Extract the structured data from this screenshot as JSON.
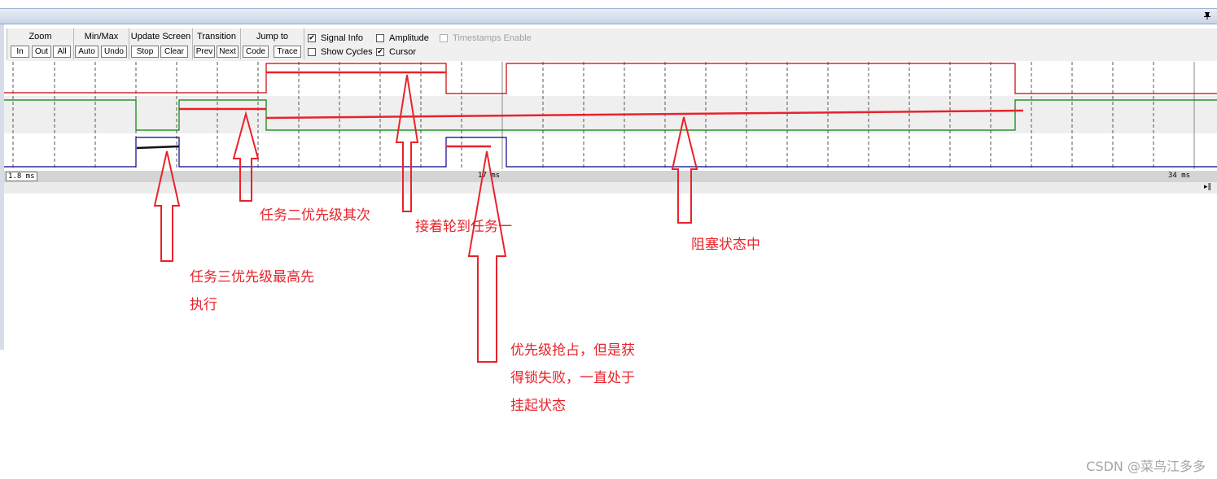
{
  "toolbar": {
    "zoom": {
      "title": "Zoom",
      "in": "In",
      "out": "Out",
      "all": "All"
    },
    "minmax": {
      "title": "Min/Max",
      "auto": "Auto",
      "undo": "Undo"
    },
    "update": {
      "title": "Update Screen",
      "stop": "Stop",
      "clear": "Clear"
    },
    "transition": {
      "title": "Transition",
      "prev": "Prev",
      "next": "Next"
    },
    "jump": {
      "title": "Jump to",
      "code": "Code",
      "trace": "Trace"
    },
    "options": {
      "signal_info": "Signal Info",
      "show_cycles": "Show Cycles",
      "amplitude": "Amplitude",
      "cursor": "Cursor",
      "timestamps": "Timestamps Enable"
    }
  },
  "checks": {
    "signal_info": true,
    "show_cycles": false,
    "amplitude": false,
    "cursor": true,
    "timestamps": false
  },
  "timeline": {
    "left": "1.8 ms",
    "cursor": "17 ms",
    "right": "34 ms"
  },
  "annotations": {
    "task3_line1": "任务三优先级最高先",
    "task3_line2": "执行",
    "task2": "任务二优先级其次",
    "task1_next": "接着轮到任务一",
    "blocked": "阻塞状态中",
    "preempt_line1": "优先级抢占，但是获",
    "preempt_line2": "得锁失败，一直处于",
    "preempt_line3": "挂起状态"
  },
  "watermark": "CSDN @菜鸟江多多",
  "colors": {
    "task_red": "#cc0000",
    "task_green": "#008000",
    "task_blue": "#00008b",
    "annotation": "#e8232b"
  },
  "icons": {
    "pin": "pin-icon",
    "check": "check-icon",
    "scroll": "scroll-arrow-icon"
  }
}
